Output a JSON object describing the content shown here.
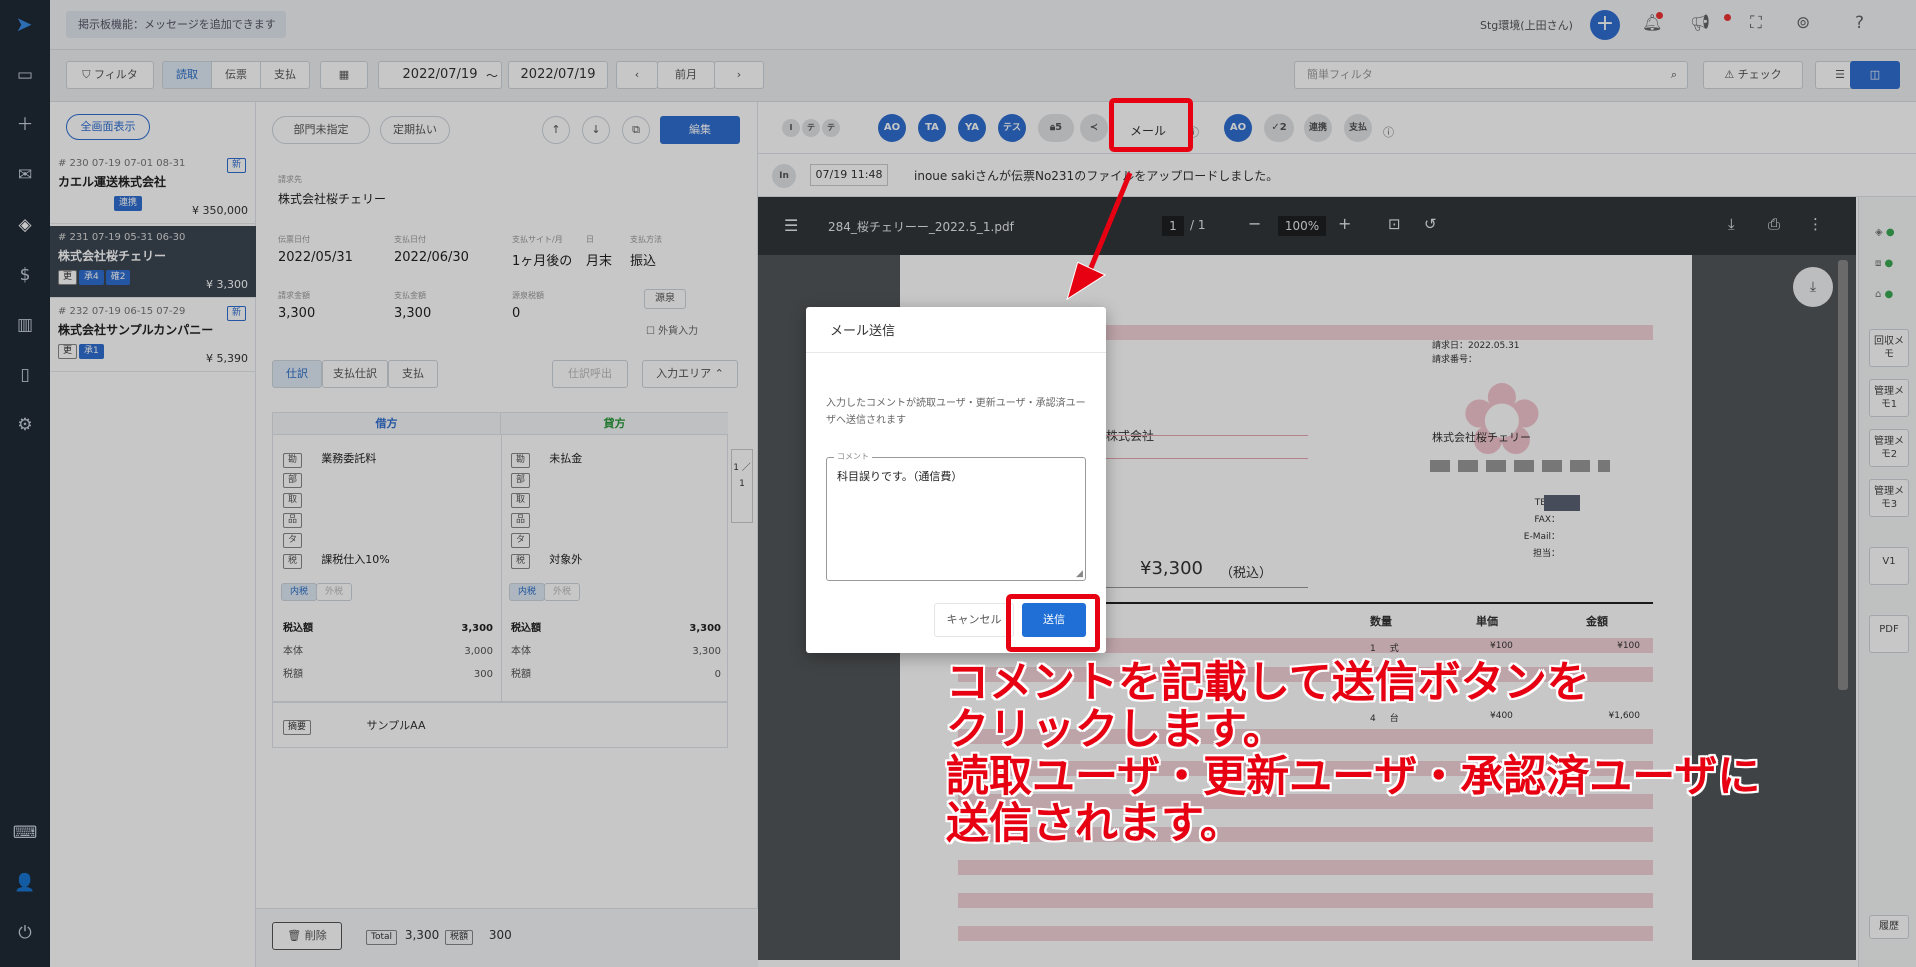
{
  "topbar": {
    "board_placeholder": "掲示板機能：メッセージを追加できます",
    "env_label": "Stg環境(上田さん)"
  },
  "toolbar": {
    "filter_label": "フィルタ",
    "tabs": [
      "読取",
      "伝票",
      "支払"
    ],
    "date_from": "2022/07/19",
    "date_sep": "〜",
    "date_to": "2022/07/19",
    "prev_month": "前月",
    "quick_filter_placeholder": "簡単フィルタ",
    "check_label": "チェック"
  },
  "list": {
    "show_all_label": "全画面表示",
    "items": [
      {
        "meta": "# 230   07-19   07-01   08-31",
        "name": "カエル運送株式会社",
        "tags": [
          "連携"
        ],
        "amount": "¥ 350,000",
        "badge": "新"
      },
      {
        "meta": "# 231   07-19   05-31   06-30",
        "name": "株式会社桜チェリー",
        "tags": [
          "更",
          "承4",
          "確2"
        ],
        "amount": "¥ 3,300",
        "badge": "新"
      },
      {
        "meta": "# 232   07-19   06-15   07-29",
        "name": "株式会社サンプルカンパニー",
        "tags": [
          "更",
          "承1"
        ],
        "amount": "¥ 5,390",
        "badge": "新"
      }
    ]
  },
  "detail": {
    "dept_btn": "部門未指定",
    "periodic_btn": "定期払い",
    "edit_btn": "編集",
    "vendor_label": "請求先",
    "vendor": "株式会社桜チェリー",
    "invoice_date_label": "伝票日付",
    "invoice_date": "2022/05/31",
    "pay_date_label": "支払日付",
    "pay_date": "2022/06/30",
    "site_label": "支払サイト/月",
    "site": "1ヶ月後の",
    "day_label": "日",
    "day": "月末",
    "method_label": "支払方法",
    "method": "振込",
    "req_amount_label": "請求金額",
    "req_amount": "3,300",
    "pay_amount_label": "支払金額",
    "pay_amount": "3,300",
    "withhold_label": "源泉税額",
    "withhold": "0",
    "gensen_btn": "源泉",
    "foreign_label": "外貨入力",
    "subtabs": [
      "仕訳",
      "支払仕訳",
      "支払"
    ],
    "journal_btn": "仕訳呼出",
    "input_area": "入力エリア",
    "debit_head": "借方",
    "credit_head": "貸方",
    "debit_account": "業務委託料",
    "debit_tax": "課税仕入10%",
    "credit_account": "未払金",
    "credit_tax": "対象外",
    "rowlabels": [
      "勘",
      "部",
      "取",
      "品",
      "タ",
      "税"
    ],
    "tax_in": "内税",
    "tax_out": "外税",
    "debit_incl": "3,300",
    "debit_body": "3,000",
    "debit_taxamt": "300",
    "credit_incl": "3,300",
    "credit_body": "3,300",
    "credit_taxamt": "0",
    "incl_label": "税込額",
    "body_label": "本体",
    "taxamt_label": "税額",
    "memo_label": "摘要",
    "memo": "サンプルAA",
    "page_indicator": "1 ／ 1",
    "delete_btn": "削除",
    "total_label": "Total",
    "total": "3,300",
    "tax_label": "税額",
    "total_tax": "300"
  },
  "approvals": {
    "avatars": [
      "AO",
      "TA",
      "YA",
      "テス"
    ],
    "lock_count": "5",
    "mail_label": "メール",
    "after_avatar": "AO",
    "check_count": "2",
    "link_label": "連携",
    "pay_label": "支払"
  },
  "log": {
    "user_initials": "In",
    "time": "07/19 11:48",
    "message": "inoue sakiさんが伝票No231のファイルをアップロードしました。"
  },
  "pdf": {
    "filename": "284_桜チェリーー_2022.5_1.pdf",
    "page": "1",
    "page_total": "/ 1",
    "zoom": "100%",
    "invoice_date": "請求日：2022.05.31",
    "invoice_no": "請求番号：",
    "company_to": "株式会社",
    "company_from": "株式会社桜チェリー",
    "tel": "TEL：",
    "fax": "FAX：",
    "email": "E-Mail：",
    "staff": "担当：",
    "total": "¥3,300",
    "tax_note": "（税込）",
    "col_qty": "数量",
    "col_unit": "単価",
    "col_amount": "金額",
    "rows": [
      {
        "qty": "1",
        "unit_label": "式",
        "unit": "¥100",
        "amount": "¥100"
      },
      {
        "qty": "4",
        "unit_label": "台",
        "unit": "¥400",
        "amount": "¥1,600"
      }
    ]
  },
  "side": {
    "buttons": [
      "回収メモ",
      "管理メモ1",
      "管理メモ2",
      "管理メモ3",
      "V1",
      "PDF"
    ],
    "history": "履歴"
  },
  "modal": {
    "title": "メール送信",
    "description": "入力したコメントが読取ユーザ・更新ユーザ・承認済ユーザへ送信されます",
    "comment_label": "コメント",
    "comment": "科目誤りです。（通信費）",
    "cancel": "キャンセル",
    "send": "送信"
  },
  "annotation": {
    "line1": "コメントを記載して送信ボタンを",
    "line2": "クリックします。",
    "line3": "読取ユーザ・更新ユーザ・承認済ユーザに",
    "line4": "送信されます。"
  },
  "colors": {
    "accent": "#2f6fd1",
    "annotation": "#e60012",
    "nav": "#1f2a36"
  }
}
